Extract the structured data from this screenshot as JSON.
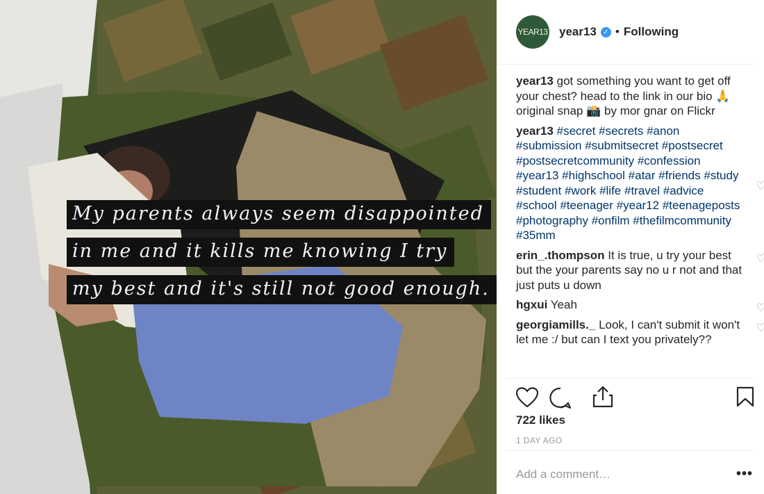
{
  "post": {
    "overlay_lines": [
      "My parents always seem disappointed",
      "in me and it kills me knowing I try",
      "my best and it's still not good enough."
    ]
  },
  "header": {
    "avatar_text": "YEAR13",
    "username": "year13",
    "separator": "•",
    "follow_status": "Following"
  },
  "comments": [
    {
      "author": "year13",
      "parts": [
        {
          "text": "got something you want to get off your chest? head to the link in our bio 🙏 original snap 📸 by mor gnar on Flickr"
        }
      ]
    },
    {
      "author": "year13",
      "tags": [
        "#secret",
        "#secrets",
        "#anon",
        "#submission",
        "#submitsecret",
        "#postsecret",
        "#postsecretcommunity",
        "#confession",
        "#year13",
        "#highschool",
        "#atar",
        "#friends",
        "#study",
        "#student",
        "#work",
        "#life",
        "#travel",
        "#advice",
        "#school",
        "#teenager",
        "#year12",
        "#teenageposts",
        "#photography",
        "#onfilm",
        "#thefilmcommunity",
        "#35mm"
      ]
    },
    {
      "author": "erin_.thompson",
      "parts": [
        {
          "text": "It is true, u try your best but the your parents say no u r not and that just puts u down"
        }
      ]
    },
    {
      "author": "hgxui",
      "parts": [
        {
          "text": "Yeah"
        }
      ]
    },
    {
      "author": "georgiamills._",
      "parts": [
        {
          "text": "Look, I can't submit it won't let me :/ but can I text you privately??"
        }
      ]
    }
  ],
  "likes": "722 likes",
  "time": "1 DAY AGO",
  "comment_input": {
    "placeholder": "Add a comment…"
  },
  "icons": {
    "heart": "heart-icon",
    "comment": "comment-icon",
    "share": "share-icon",
    "bookmark": "bookmark-icon",
    "more": "more-options-icon",
    "verified": "verified-badge-icon"
  },
  "colors": {
    "link": "#003569",
    "verified": "#3897f0",
    "muted": "#999999"
  }
}
